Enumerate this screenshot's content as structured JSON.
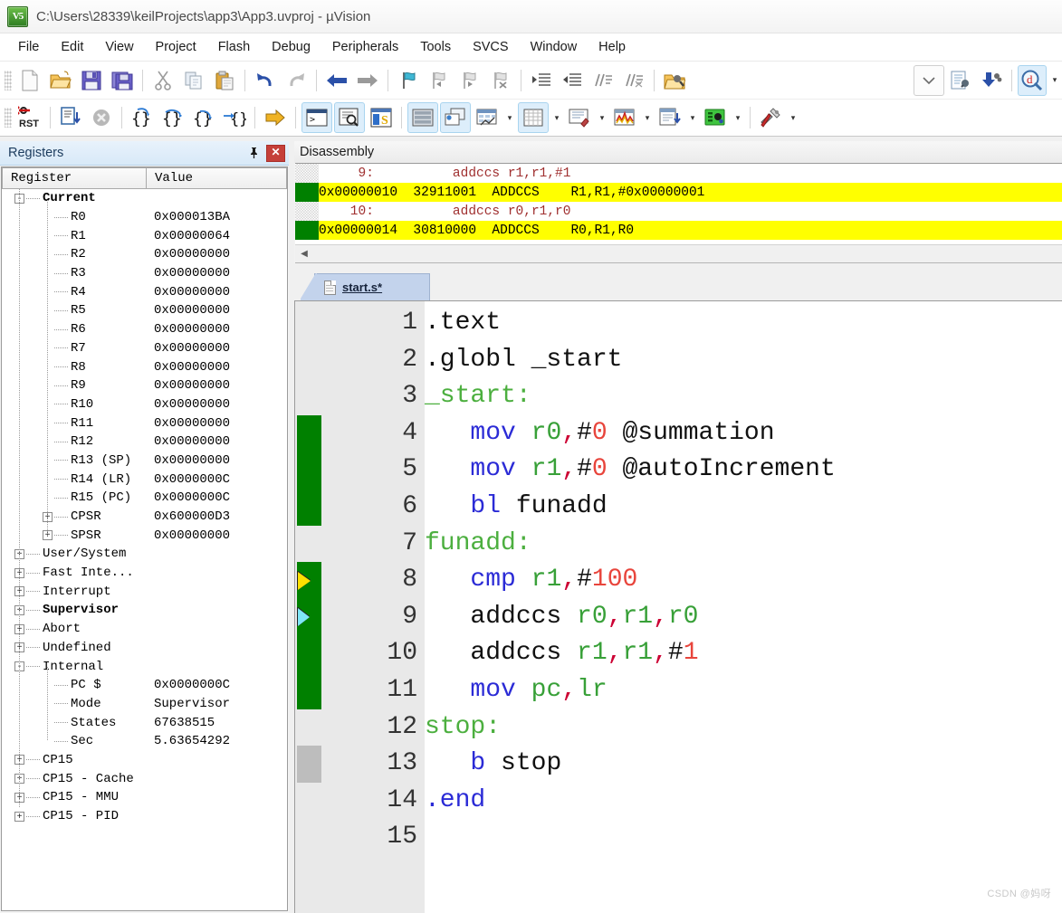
{
  "window": {
    "title": "C:\\Users\\28339\\keilProjects\\app3\\App3.uvproj - µVision",
    "logo_text": "V5"
  },
  "menubar": {
    "items": [
      "File",
      "Edit",
      "View",
      "Project",
      "Flash",
      "Debug",
      "Peripherals",
      "Tools",
      "SVCS",
      "Window",
      "Help"
    ]
  },
  "toolbar_main": {
    "icons": [
      "new-file-icon",
      "open-folder-icon",
      "save-icon",
      "save-all-icon",
      "cut-icon",
      "copy-icon",
      "paste-icon",
      "undo-icon",
      "redo-icon",
      "navigate-back-icon",
      "navigate-forward-icon",
      "bookmark-toggle-icon",
      "bookmark-prev-icon",
      "bookmark-next-icon",
      "bookmark-clear-icon",
      "indent-icon",
      "outdent-icon",
      "comment-icon",
      "uncomment-icon",
      "find-in-files-icon",
      "dropdown-icon",
      "configure-target-icon",
      "download-icon",
      "debug-session-icon"
    ]
  },
  "toolbar_debug": {
    "icons": [
      "reset-icon",
      "run-icon",
      "stop-icon",
      "step-icon",
      "step-over-icon",
      "step-out-icon",
      "run-to-cursor-icon",
      "show-statement-icon",
      "command-window-icon",
      "disassembly-window-icon",
      "symbols-window-icon",
      "registers-window-icon",
      "call-stack-icon",
      "watch-window-icon",
      "memory-window-icon",
      "serial-window-icon",
      "analysis-window-icon",
      "trace-icon",
      "system-viewer-icon",
      "toolbox-icon"
    ]
  },
  "registers_panel": {
    "title": "Registers",
    "pin_icon": "pin-icon",
    "close_icon": "close-icon",
    "columns": [
      "Register",
      "Value"
    ],
    "rows": [
      {
        "indent": 0,
        "toggle": "-",
        "label": "Current",
        "value": "",
        "bold": true
      },
      {
        "indent": 1,
        "toggle": "",
        "label": "R0",
        "value": "0x000013BA",
        "bold": false
      },
      {
        "indent": 1,
        "toggle": "",
        "label": "R1",
        "value": "0x00000064",
        "bold": false
      },
      {
        "indent": 1,
        "toggle": "",
        "label": "R2",
        "value": "0x00000000",
        "bold": false
      },
      {
        "indent": 1,
        "toggle": "",
        "label": "R3",
        "value": "0x00000000",
        "bold": false
      },
      {
        "indent": 1,
        "toggle": "",
        "label": "R4",
        "value": "0x00000000",
        "bold": false
      },
      {
        "indent": 1,
        "toggle": "",
        "label": "R5",
        "value": "0x00000000",
        "bold": false
      },
      {
        "indent": 1,
        "toggle": "",
        "label": "R6",
        "value": "0x00000000",
        "bold": false
      },
      {
        "indent": 1,
        "toggle": "",
        "label": "R7",
        "value": "0x00000000",
        "bold": false
      },
      {
        "indent": 1,
        "toggle": "",
        "label": "R8",
        "value": "0x00000000",
        "bold": false
      },
      {
        "indent": 1,
        "toggle": "",
        "label": "R9",
        "value": "0x00000000",
        "bold": false
      },
      {
        "indent": 1,
        "toggle": "",
        "label": "R10",
        "value": "0x00000000",
        "bold": false
      },
      {
        "indent": 1,
        "toggle": "",
        "label": "R11",
        "value": "0x00000000",
        "bold": false
      },
      {
        "indent": 1,
        "toggle": "",
        "label": "R12",
        "value": "0x00000000",
        "bold": false
      },
      {
        "indent": 1,
        "toggle": "",
        "label": "R13 (SP)",
        "value": "0x00000000",
        "bold": false
      },
      {
        "indent": 1,
        "toggle": "",
        "label": "R14 (LR)",
        "value": "0x0000000C",
        "bold": false
      },
      {
        "indent": 1,
        "toggle": "",
        "label": "R15 (PC)",
        "value": "0x0000000C",
        "bold": false
      },
      {
        "indent": 1,
        "toggle": "+",
        "label": "CPSR",
        "value": "0x600000D3",
        "bold": false
      },
      {
        "indent": 1,
        "toggle": "+",
        "label": "SPSR",
        "value": "0x00000000",
        "bold": false
      },
      {
        "indent": 0,
        "toggle": "+",
        "label": "User/System",
        "value": "",
        "bold": false
      },
      {
        "indent": 0,
        "toggle": "+",
        "label": "Fast Inte...",
        "value": "",
        "bold": false
      },
      {
        "indent": 0,
        "toggle": "+",
        "label": "Interrupt",
        "value": "",
        "bold": false
      },
      {
        "indent": 0,
        "toggle": "+",
        "label": "Supervisor",
        "value": "",
        "bold": true
      },
      {
        "indent": 0,
        "toggle": "+",
        "label": "Abort",
        "value": "",
        "bold": false
      },
      {
        "indent": 0,
        "toggle": "+",
        "label": "Undefined",
        "value": "",
        "bold": false
      },
      {
        "indent": 0,
        "toggle": "-",
        "label": "Internal",
        "value": "",
        "bold": false
      },
      {
        "indent": 1,
        "toggle": "",
        "label": "PC  $",
        "value": "0x0000000C",
        "bold": false
      },
      {
        "indent": 1,
        "toggle": "",
        "label": "Mode",
        "value": "Supervisor",
        "bold": false
      },
      {
        "indent": 1,
        "toggle": "",
        "label": "States",
        "value": "67638515",
        "bold": false
      },
      {
        "indent": 1,
        "toggle": "",
        "label": "Sec",
        "value": "5.63654292",
        "bold": false
      },
      {
        "indent": 0,
        "toggle": "+",
        "label": "CP15",
        "value": "",
        "bold": false
      },
      {
        "indent": 0,
        "toggle": "+",
        "label": "CP15 - Cache",
        "value": "",
        "bold": false
      },
      {
        "indent": 0,
        "toggle": "+",
        "label": "CP15 - MMU",
        "value": "",
        "bold": false
      },
      {
        "indent": 0,
        "toggle": "+",
        "label": "CP15 - PID",
        "value": "",
        "bold": false
      }
    ]
  },
  "disassembly_panel": {
    "title": "Disassembly",
    "lines": [
      {
        "type": "source",
        "marker": "hatch",
        "text": "     9:          addccs r1,r1,#1 "
      },
      {
        "type": "asm",
        "marker": "green",
        "text": "0x00000010  32911001  ADDCCS    R1,R1,#0x00000001"
      },
      {
        "type": "source",
        "marker": "hatch",
        "text": "    10:          addccs r0,r1,r0 "
      },
      {
        "type": "asm",
        "marker": "green",
        "text": "0x00000014  30810000  ADDCCS    R0,R1,R0"
      }
    ],
    "highlight_color": "#ffff00",
    "scroll_left_icon": "scroll-left-icon"
  },
  "editor": {
    "tab": {
      "label": "start.s*",
      "icon": "document-icon"
    },
    "lines": [
      {
        "n": "1",
        "mark": "none",
        "arrow": "none",
        "tokens": [
          {
            "t": ".text",
            "c": "plain"
          }
        ]
      },
      {
        "n": "2",
        "mark": "none",
        "arrow": "none",
        "tokens": [
          {
            "t": ".globl _start",
            "c": "plain"
          }
        ]
      },
      {
        "n": "3",
        "mark": "none",
        "arrow": "none",
        "tokens": [
          {
            "t": "_start:",
            "c": "label"
          }
        ]
      },
      {
        "n": "4",
        "mark": "green",
        "arrow": "none",
        "tokens": [
          {
            "t": "   ",
            "c": "plain"
          },
          {
            "t": "mov",
            "c": "kw"
          },
          {
            "t": " ",
            "c": "plain"
          },
          {
            "t": "r0",
            "c": "reg"
          },
          {
            "t": ",",
            "c": "punct"
          },
          {
            "t": "#",
            "c": "plain"
          },
          {
            "t": "0",
            "c": "num"
          },
          {
            "t": " @summation",
            "c": "comment"
          }
        ]
      },
      {
        "n": "5",
        "mark": "green",
        "arrow": "none",
        "tokens": [
          {
            "t": "   ",
            "c": "plain"
          },
          {
            "t": "mov",
            "c": "kw"
          },
          {
            "t": " ",
            "c": "plain"
          },
          {
            "t": "r1",
            "c": "reg"
          },
          {
            "t": ",",
            "c": "punct"
          },
          {
            "t": "#",
            "c": "plain"
          },
          {
            "t": "0",
            "c": "num"
          },
          {
            "t": " @autoIncrement",
            "c": "comment"
          }
        ]
      },
      {
        "n": "6",
        "mark": "green",
        "arrow": "none",
        "tokens": [
          {
            "t": "   ",
            "c": "plain"
          },
          {
            "t": "bl",
            "c": "kw"
          },
          {
            "t": " funadd",
            "c": "plain"
          }
        ]
      },
      {
        "n": "7",
        "mark": "none",
        "arrow": "none",
        "tokens": [
          {
            "t": "funadd:",
            "c": "label"
          }
        ]
      },
      {
        "n": "8",
        "mark": "green",
        "arrow": "yellow",
        "tokens": [
          {
            "t": "   ",
            "c": "plain"
          },
          {
            "t": "cmp",
            "c": "kw"
          },
          {
            "t": " ",
            "c": "plain"
          },
          {
            "t": "r1",
            "c": "reg"
          },
          {
            "t": ",",
            "c": "punct"
          },
          {
            "t": "#",
            "c": "plain"
          },
          {
            "t": "100",
            "c": "num"
          }
        ]
      },
      {
        "n": "9",
        "mark": "green",
        "arrow": "cyan",
        "tokens": [
          {
            "t": "   addccs ",
            "c": "plain"
          },
          {
            "t": "r0",
            "c": "reg"
          },
          {
            "t": ",",
            "c": "punct"
          },
          {
            "t": "r1",
            "c": "reg"
          },
          {
            "t": ",",
            "c": "punct"
          },
          {
            "t": "r0",
            "c": "reg"
          }
        ]
      },
      {
        "n": "10",
        "mark": "green",
        "arrow": "none",
        "tokens": [
          {
            "t": "   addccs ",
            "c": "plain"
          },
          {
            "t": "r1",
            "c": "reg"
          },
          {
            "t": ",",
            "c": "punct"
          },
          {
            "t": "r1",
            "c": "reg"
          },
          {
            "t": ",",
            "c": "punct"
          },
          {
            "t": "#",
            "c": "plain"
          },
          {
            "t": "1",
            "c": "num"
          }
        ]
      },
      {
        "n": "11",
        "mark": "green",
        "arrow": "none",
        "tokens": [
          {
            "t": "   ",
            "c": "plain"
          },
          {
            "t": "mov",
            "c": "kw"
          },
          {
            "t": " ",
            "c": "plain"
          },
          {
            "t": "pc",
            "c": "reg"
          },
          {
            "t": ",",
            "c": "punct"
          },
          {
            "t": "lr",
            "c": "reg"
          }
        ]
      },
      {
        "n": "12",
        "mark": "none",
        "arrow": "none",
        "tokens": [
          {
            "t": "stop:",
            "c": "label"
          }
        ]
      },
      {
        "n": "13",
        "mark": "gray",
        "arrow": "none",
        "tokens": [
          {
            "t": "   ",
            "c": "plain"
          },
          {
            "t": "b",
            "c": "kw"
          },
          {
            "t": " stop",
            "c": "plain"
          }
        ]
      },
      {
        "n": "14",
        "mark": "none",
        "arrow": "none",
        "tokens": [
          {
            "t": ".end",
            "c": "kw"
          }
        ]
      },
      {
        "n": "15",
        "mark": "none",
        "arrow": "none",
        "tokens": []
      }
    ]
  },
  "watermark": "CSDN @妈呀"
}
